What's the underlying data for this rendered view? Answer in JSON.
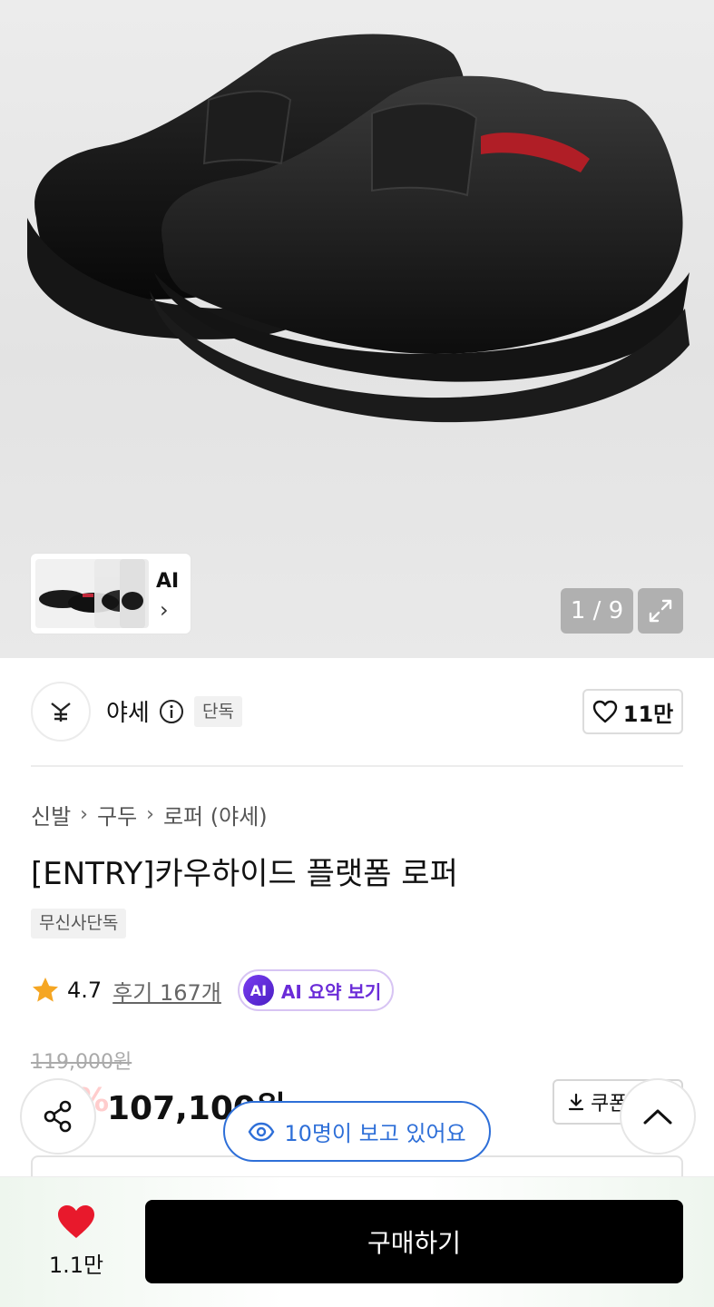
{
  "gallery": {
    "counter": "1 / 9",
    "thumb_ai_label": "AI",
    "thumb_chevron": "›"
  },
  "brand": {
    "name": "야세",
    "exclusive_badge": "단독",
    "like_count": "11만"
  },
  "product": {
    "breadcrumb": [
      "신발",
      "구두",
      "로퍼 (야세)"
    ],
    "breadcrumb_separator": "›",
    "title": "[ENTRY]카우하이드 플랫폼 로퍼",
    "tag": "무신사단독",
    "rating": "4.7",
    "reviews_link": "후기 167개",
    "ai_badge": "AI",
    "ai_summary_label": "AI 요약 보기"
  },
  "price": {
    "original": "119,000원",
    "discount": "10%",
    "current": "107,100원",
    "coupon_label": "쿠폰 받기"
  },
  "floating": {
    "viewers": "10명이 보고 있어요"
  },
  "bottom_bar": {
    "wish_count": "1.1만",
    "buy_label": "구매하기"
  },
  "colors": {
    "accent_blue": "#2e6fd8",
    "ai_purple": "#6a2bd8",
    "heart_red": "#e8192c",
    "star_orange": "#f5a623"
  }
}
